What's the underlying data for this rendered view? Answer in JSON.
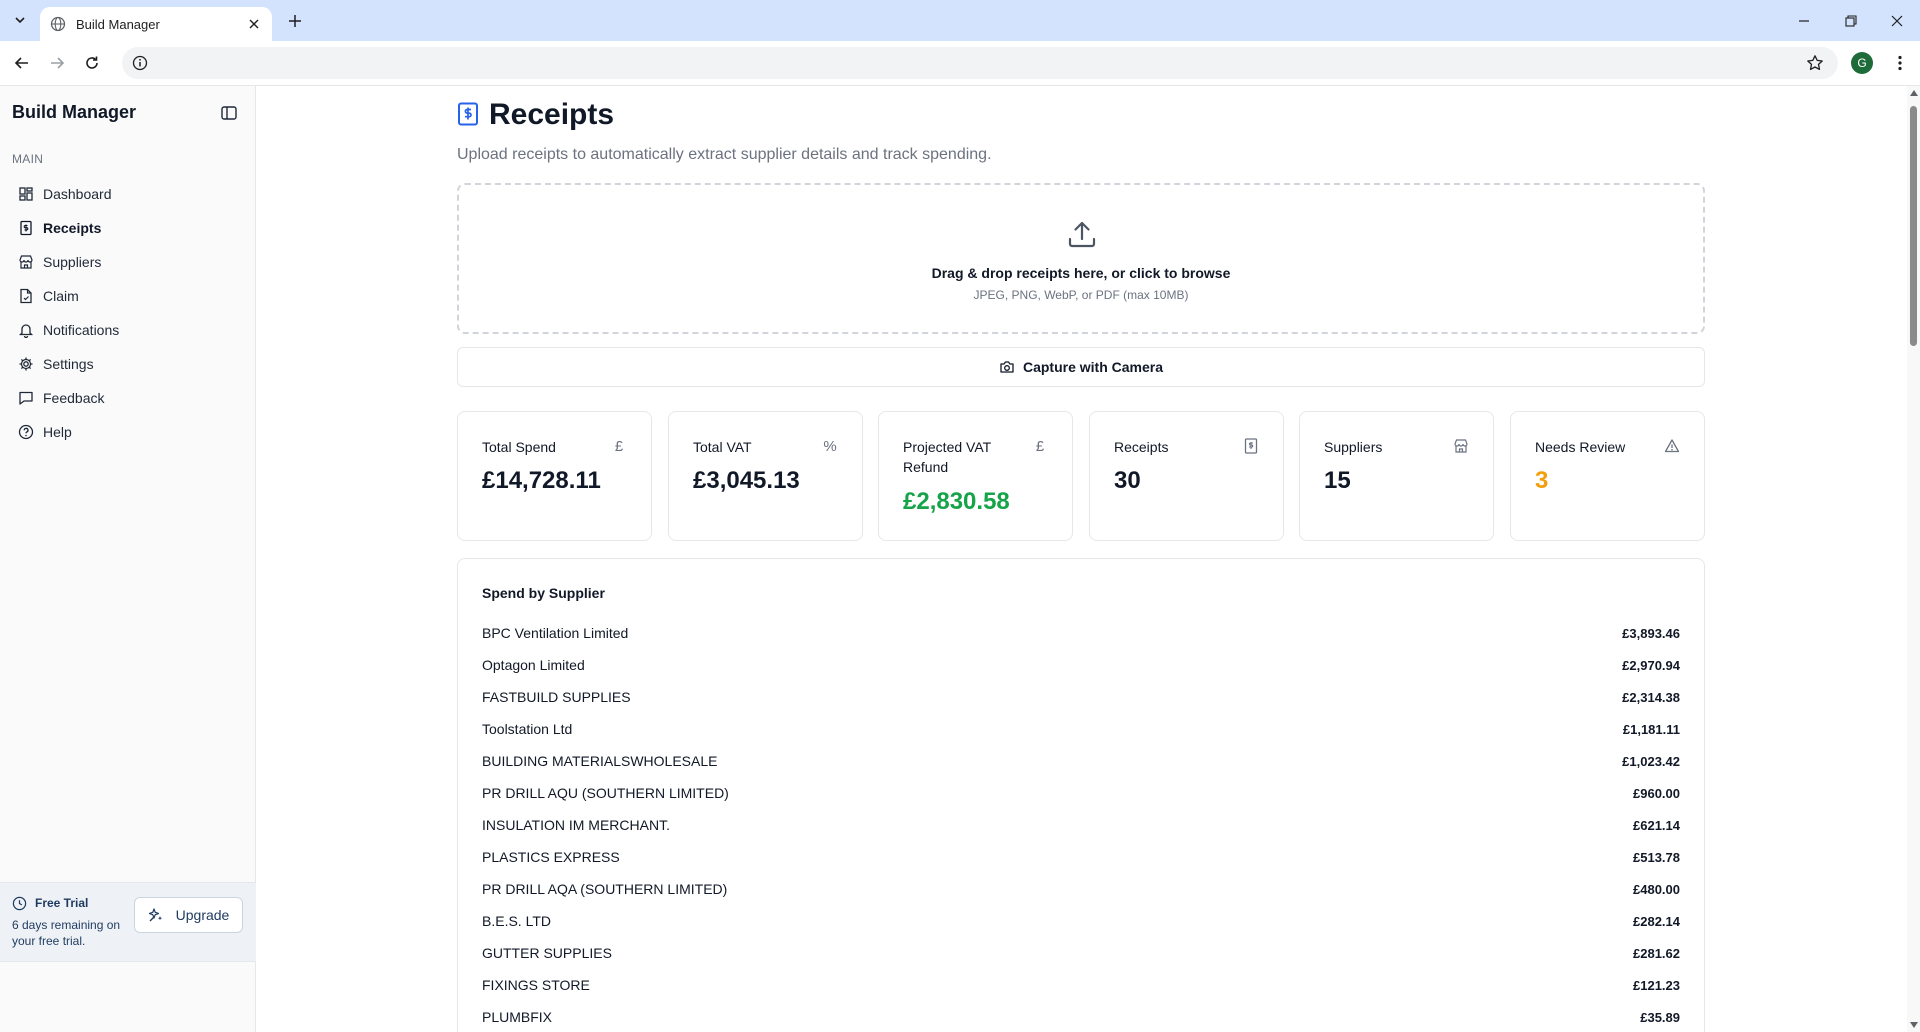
{
  "browser": {
    "tab_title": "Build Manager",
    "avatar_letter": "G"
  },
  "sidebar": {
    "brand": "Build Manager",
    "section_label": "MAIN",
    "items": [
      {
        "label": "Dashboard",
        "icon": "dashboard-icon"
      },
      {
        "label": "Receipts",
        "icon": "receipt-icon"
      },
      {
        "label": "Suppliers",
        "icon": "store-icon"
      },
      {
        "label": "Claim",
        "icon": "document-icon"
      },
      {
        "label": "Notifications",
        "icon": "bell-icon"
      },
      {
        "label": "Settings",
        "icon": "gear-icon"
      },
      {
        "label": "Feedback",
        "icon": "message-icon"
      },
      {
        "label": "Help",
        "icon": "help-icon"
      }
    ],
    "active_item": "Receipts",
    "trial": {
      "title": "Free Trial",
      "text": "6 days remaining on your free trial.",
      "upgrade_label": "Upgrade"
    }
  },
  "page": {
    "title": "Receipts",
    "subtitle": "Upload receipts to automatically extract supplier details and track spending.",
    "dropzone": {
      "title": "Drag & drop receipts here, or click to browse",
      "hint": "JPEG, PNG, WebP, or PDF (max 10MB)"
    },
    "camera_label": "Capture with Camera"
  },
  "stats": [
    {
      "label": "Total Spend",
      "value": "£14,728.11",
      "icon": "£"
    },
    {
      "label": "Total VAT",
      "value": "£3,045.13",
      "icon": "%"
    },
    {
      "label": "Projected VAT Refund",
      "value": "£2,830.58",
      "icon": "£"
    },
    {
      "label": "Receipts",
      "value": "30",
      "icon": "receipt-icon"
    },
    {
      "label": "Suppliers",
      "value": "15",
      "icon": "store-icon"
    },
    {
      "label": "Needs Review",
      "value": "3",
      "icon": "warning-icon"
    }
  ],
  "colors": {
    "refund_green": "#16a34a",
    "review_orange": "#f59e0b",
    "accent_blue": "#2563eb"
  },
  "spend_by_supplier": {
    "title": "Spend by Supplier",
    "rows": [
      {
        "name": "BPC Ventilation Limited",
        "amount": "£3,893.46"
      },
      {
        "name": "Optagon Limited",
        "amount": "£2,970.94"
      },
      {
        "name": "FASTBUILD SUPPLIES",
        "amount": "£2,314.38"
      },
      {
        "name": "Toolstation Ltd",
        "amount": "£1,181.11"
      },
      {
        "name": "BUILDING MATERIALSWHOLESALE",
        "amount": "£1,023.42"
      },
      {
        "name": "PR DRILL AQU (SOUTHERN LIMITED)",
        "amount": "£960.00"
      },
      {
        "name": "INSULATION IM MERCHANT.",
        "amount": "£621.14"
      },
      {
        "name": "PLASTICS EXPRESS",
        "amount": "£513.78"
      },
      {
        "name": "PR DRILL AQA (SOUTHERN LIMITED)",
        "amount": "£480.00"
      },
      {
        "name": "B.E.S. LTD",
        "amount": "£282.14"
      },
      {
        "name": "GUTTER SUPPLIES",
        "amount": "£281.62"
      },
      {
        "name": "FIXINGS STORE",
        "amount": "£121.23"
      },
      {
        "name": "PLUMBFIX",
        "amount": "£35.89"
      }
    ]
  }
}
